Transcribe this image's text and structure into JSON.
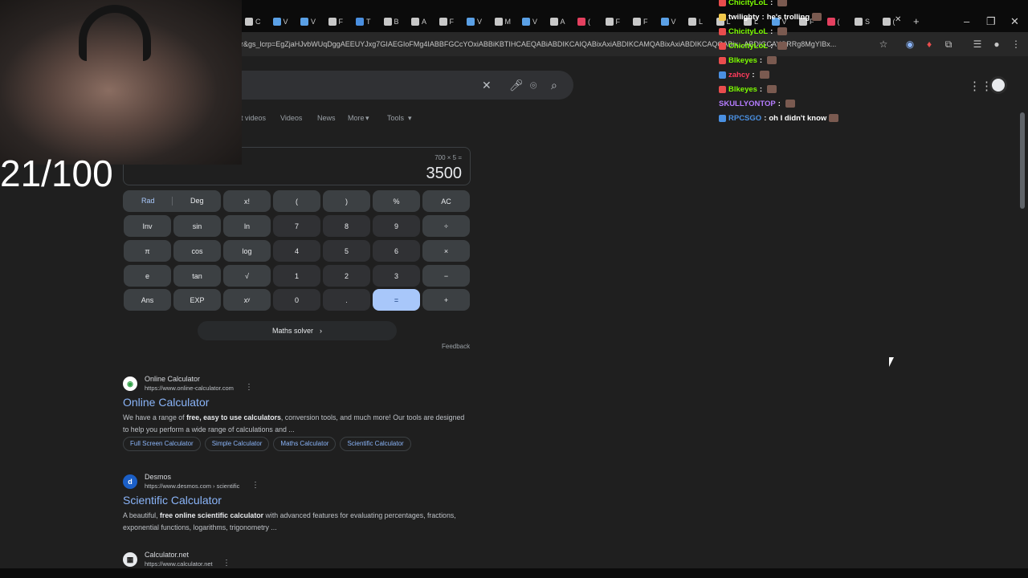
{
  "browser": {
    "url": "r&gs_lcrp=EgZjaHJvbWUqDggAEEUYJxg7GIAEGIoFMg4IABBFGCcYOxiABBiKBTIHCAEQABiABDIKCAIQABixAxiABDIKCAMQABixAxiABDIKCAQQABix...ABDIGCAYQRRg8MgYIBx...",
    "tab_labels": [
      "C",
      "V",
      "V",
      "F",
      "T",
      "B",
      "A",
      "F",
      "V",
      "M",
      "V",
      "A",
      "(",
      "F",
      "F",
      "V",
      "L",
      "L",
      "L",
      "V",
      "F",
      "(",
      "S",
      "("
    ],
    "window_controls": {
      "minimize": "–",
      "maximize": "❐",
      "close": "✕",
      "new_tab": "+",
      "tab_close": "✕"
    }
  },
  "search": {
    "tabs": [
      "t videos",
      "Videos",
      "News",
      "More",
      "Tools"
    ]
  },
  "stream": {
    "counter": "21/100",
    "chat": [
      {
        "user": "ChicityLoL",
        "color": "#7CFC00",
        "message": ""
      },
      {
        "user": "twilighty",
        "color": "#ffffff",
        "message": "he's trolling"
      },
      {
        "user": "ChicityLoL",
        "color": "#7CFC00",
        "message": ""
      },
      {
        "user": "ChicityLoL",
        "color": "#7CFC00",
        "message": ""
      },
      {
        "user": "Blkeyes",
        "color": "#7CFC00",
        "message": ""
      },
      {
        "user": "zahcy",
        "color": "#ff3b5c",
        "message": ""
      },
      {
        "user": "Blkeyes",
        "color": "#7CFC00",
        "message": ""
      },
      {
        "user": "SKULLYONTOP",
        "color": "#b57cff",
        "message": ""
      },
      {
        "user": "RPCSGO",
        "color": "#4a90e2",
        "message": "oh I didn't know"
      }
    ]
  },
  "calculator": {
    "expression": "700 × 5 =",
    "result": "3500",
    "rad": "Rad",
    "deg": "Deg",
    "keys": [
      [
        "x!",
        "(",
        ")",
        "%",
        "AC"
      ],
      [
        "Inv",
        "sin",
        "ln",
        "7",
        "8",
        "9",
        "÷"
      ],
      [
        "π",
        "cos",
        "log",
        "4",
        "5",
        "6",
        "×"
      ],
      [
        "e",
        "tan",
        "√",
        "1",
        "2",
        "3",
        "−"
      ],
      [
        "Ans",
        "EXP",
        "xʸ",
        "0",
        ".",
        "=",
        "+"
      ]
    ],
    "solver_label": "Maths solver",
    "feedback": "Feedback"
  },
  "results": [
    {
      "site": "Online Calculator",
      "cite": "https://www.online-calculator.com",
      "title": "Online Calculator",
      "snippet_pre": "We have a range of ",
      "snippet_bold": "free, easy to use calculators",
      "snippet_post": ", conversion tools, and much more! Our tools are designed to help you perform a wide range of calculations and ...",
      "sitelinks": [
        "Full Screen Calculator",
        "Simple Calculator",
        "Maths Calculator",
        "Scientific Calculator"
      ]
    },
    {
      "site": "Desmos",
      "cite": "https://www.desmos.com › scientific",
      "title": "Scientific Calculator",
      "snippet_pre": "A beautiful, ",
      "snippet_bold": "free online scientific calculator",
      "snippet_post": " with advanced features for evaluating percentages, fractions, exponential functions, logarithms, trigonometry ..."
    },
    {
      "site": "Calculator.net",
      "cite": "https://www.calculator.net"
    }
  ],
  "colors": {
    "accent": "#8ab4f8",
    "equals_key": "#a8c7fa",
    "background": "#1f1f1f"
  }
}
